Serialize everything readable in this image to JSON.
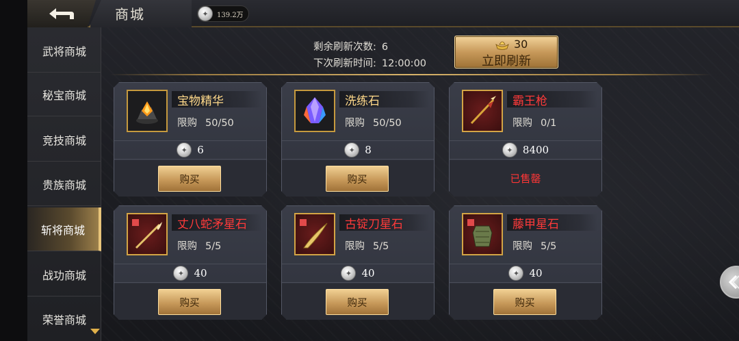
{
  "header": {
    "title": "商城",
    "currency_value": "139.2万"
  },
  "sidebar": {
    "items": [
      {
        "label": "武将商城"
      },
      {
        "label": "秘宝商城"
      },
      {
        "label": "竞技商城"
      },
      {
        "label": "贵族商城"
      },
      {
        "label": "斩将商城"
      },
      {
        "label": "战功商城"
      },
      {
        "label": "荣誉商城"
      }
    ],
    "active_index": 4
  },
  "refresh": {
    "remaining_label": "剩余刷新次数:",
    "remaining_value": "6",
    "next_label": "下次刷新时间:",
    "next_value": "12:00:00",
    "cost": "30",
    "button_label": "立即刷新"
  },
  "items": [
    {
      "name": "宝物精华",
      "limit_label": "限购",
      "limit_value": "50/50",
      "price": "6",
      "action": "购买",
      "icon": "gem-essence-icon"
    },
    {
      "name": "洗练石",
      "limit_label": "限购",
      "limit_value": "50/50",
      "price": "8",
      "action": "购买",
      "icon": "crystal-icon"
    },
    {
      "name": "霸王枪",
      "limit_label": "限购",
      "limit_value": "0/1",
      "price": "8400",
      "action": "已售罄",
      "icon": "spear-icon"
    },
    {
      "name": "丈八蛇矛星石",
      "limit_label": "限购",
      "limit_value": "5/5",
      "price": "40",
      "action": "购买",
      "icon": "serpent-spear-icon"
    },
    {
      "name": "古锭刀星石",
      "limit_label": "限购",
      "limit_value": "5/5",
      "price": "40",
      "action": "购买",
      "icon": "saber-icon"
    },
    {
      "name": "藤甲星石",
      "limit_label": "限购",
      "limit_value": "5/5",
      "price": "40",
      "action": "购买",
      "icon": "armor-icon"
    }
  ],
  "colors": {
    "accent_gold": "#d9b46a",
    "name_gold": "#ffd98a",
    "name_red": "#ff3a3a",
    "sold_out": "#ff3636"
  }
}
